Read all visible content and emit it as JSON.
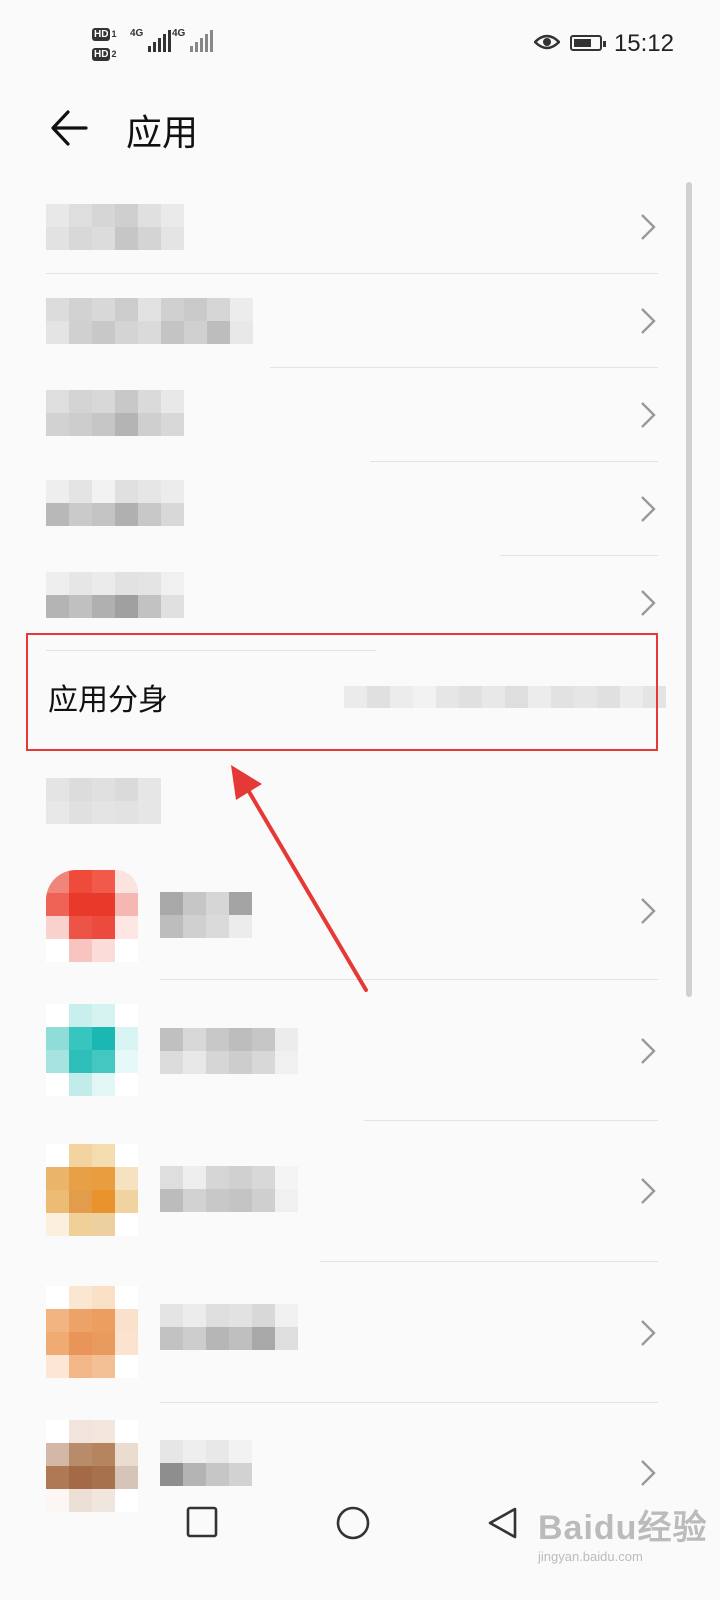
{
  "status_bar": {
    "sim1_label": "HD",
    "sim1_index": "1",
    "sim2_label": "HD",
    "sim2_index": "2",
    "network1": "4G",
    "network2": "4G",
    "time": "15:12",
    "icons": [
      "eye-comfort-icon",
      "battery-icon",
      "signal-icon"
    ]
  },
  "header": {
    "title": "应用",
    "back_icon": "arrow-left-icon"
  },
  "clone_item": {
    "label": "应用分身"
  },
  "navbar": {
    "icons": [
      "square-recents-icon",
      "circle-home-icon",
      "triangle-back-icon"
    ]
  },
  "watermark": {
    "brand": "Baidu经验",
    "url": "jingyan.baidu.com"
  },
  "colors": {
    "highlight": "#e53935",
    "arrow": "#e53935",
    "background": "#fafafa"
  }
}
